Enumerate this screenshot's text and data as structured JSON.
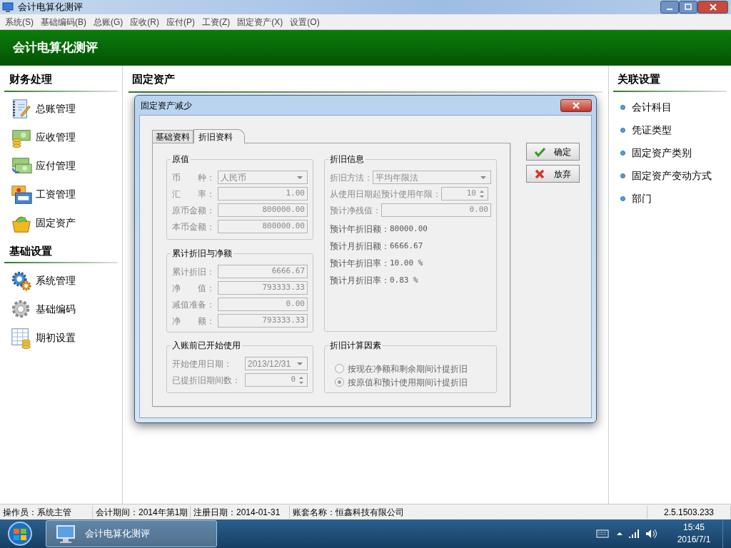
{
  "window": {
    "title": "会计电算化测评"
  },
  "menu": [
    "系统(S)",
    "基础编码(B)",
    "总账(G)",
    "应收(R)",
    "应付(P)",
    "工资(Z)",
    "固定资产(X)",
    "设置(O)"
  ],
  "header": {
    "title": "会计电算化测评"
  },
  "left_sidebar": {
    "sections": [
      {
        "title": "财务处理",
        "items": [
          "总账管理",
          "应收管理",
          "应付管理",
          "工资管理",
          "固定资产"
        ]
      },
      {
        "title": "基础设置",
        "items": [
          "系统管理",
          "基础编码",
          "期初设置"
        ]
      }
    ]
  },
  "center": {
    "title": "固定资产"
  },
  "right_sidebar": {
    "title": "关联设置",
    "items": [
      "会计科目",
      "凭证类型",
      "固定资产类别",
      "固定资产变动方式",
      "部门"
    ]
  },
  "dialog": {
    "title": "固定资产减少",
    "tabs": [
      {
        "label": "基础资料",
        "selected": false
      },
      {
        "label": "折旧资料",
        "selected": true
      }
    ],
    "groups": [
      {
        "title": "原值",
        "fields": [
          {
            "label": "币　　种：",
            "value": "人民币",
            "kind": "select",
            "disabled": true
          },
          {
            "label": "汇　　率：",
            "value": "1.00",
            "kind": "text",
            "disabled": true
          },
          {
            "label": "原币金额：",
            "value": "800000.00",
            "kind": "text",
            "disabled": true
          },
          {
            "label": "本币金额：",
            "value": "800000.00",
            "kind": "text",
            "disabled": true
          }
        ]
      },
      {
        "title": "累计折旧与净额",
        "fields": [
          {
            "label": "累计折旧：",
            "value": "6666.67",
            "kind": "text",
            "disabled": true
          },
          {
            "label": "净　　值：",
            "value": "793333.33",
            "kind": "text",
            "disabled": true
          },
          {
            "label": "减值准备：",
            "value": "0.00",
            "kind": "text",
            "disabled": true
          },
          {
            "label": "净　　额：",
            "value": "793333.33",
            "kind": "text",
            "disabled": true
          }
        ]
      },
      {
        "title": "入账前已开始使用",
        "fields": [
          {
            "label": "开始使用日期：",
            "value": "2013/12/31",
            "kind": "select",
            "disabled": true
          },
          {
            "label": "已提折旧期间数：",
            "value": "0",
            "kind": "spin",
            "disabled": true
          }
        ]
      },
      {
        "title": "折旧信息",
        "fields": [
          {
            "label": "折旧方法：",
            "value": "平均年限法",
            "kind": "select",
            "disabled": true
          },
          {
            "label": "从使用日期起预计使用年限：",
            "value": "10",
            "kind": "spin",
            "disabled": true
          },
          {
            "label": "预计净残值：",
            "value": "0.00",
            "kind": "text",
            "disabled": true
          },
          {
            "label": "预计年折旧额：",
            "value": "80000.00",
            "kind": "readout"
          },
          {
            "label": "预计月折旧额：",
            "value": "6666.67",
            "kind": "readout"
          },
          {
            "label": "预计年折旧率：",
            "value": "10.00 %",
            "kind": "readout"
          },
          {
            "label": "预计月折旧率：",
            "value": "0.83 %",
            "kind": "readout"
          }
        ]
      },
      {
        "title": "折旧计算因素",
        "fields": [
          {
            "label": "按现在净额和剩余期间计提折旧",
            "kind": "radio",
            "selected": false,
            "disabled": true
          },
          {
            "label": "按原值和预计使用期间计提折旧",
            "kind": "radio",
            "selected": true,
            "disabled": true
          }
        ]
      }
    ],
    "buttons": [
      {
        "label": "确定",
        "kind": "confirm"
      },
      {
        "label": "放弃",
        "kind": "cancel"
      }
    ]
  },
  "status_bar": [
    "操作员：系统主管",
    "会计期间：2014年第1期",
    "注册日期：2014-01-31",
    "账套名称：恒鑫科技有限公司",
    "2.5.1503.233"
  ],
  "taskbar": {
    "app": "会计电算化测评",
    "time": "15:45",
    "date": "2016/7/1"
  }
}
